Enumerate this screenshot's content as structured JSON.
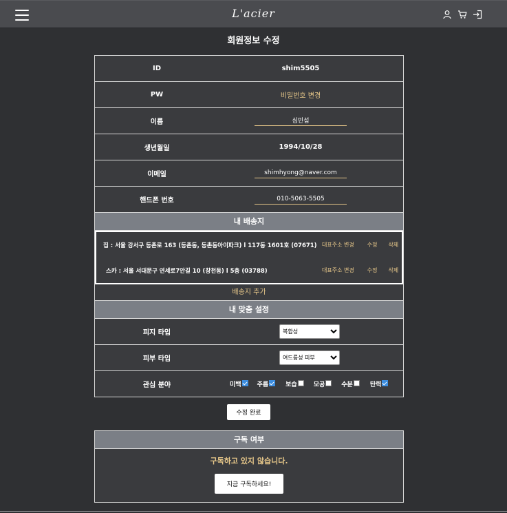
{
  "header": {
    "logo": "L'acier",
    "icons": [
      "user-icon",
      "cart-icon",
      "login-icon"
    ]
  },
  "page": {
    "title": "회원정보 수정"
  },
  "profile": {
    "id_label": "ID",
    "id_value": "shim5505",
    "pw_label": "PW",
    "pw_link": "비밀번호 변경",
    "name_label": "이름",
    "name_value": "심민섭",
    "birth_label": "생년월일",
    "birth_value": "1994/10/28",
    "email_label": "이메일",
    "email_value": "shimhyong@naver.com",
    "phone_label": "핸드폰 번호",
    "phone_value": "010-5063-5505"
  },
  "shipping": {
    "title": "내 배송지",
    "addresses": [
      {
        "text": "집 : 서울 강서구 등촌로 163 (등촌동, 등촌동아이파크) l 117동 1601호 (07671)",
        "set_default": "대표주소 변경",
        "edit": "수정",
        "delete": "삭제"
      },
      {
        "text": "스카 : 서울 서대문구 연세로7안길 10 (창천동) l 5층 (03788)",
        "set_default": "대표주소 변경",
        "edit": "수정",
        "delete": "삭제"
      }
    ],
    "add_label": "배송지 추가"
  },
  "custom": {
    "title": "내 맞춤 설정",
    "skin_type_label": "피지 타입",
    "skin_type_value": "복합성",
    "skin_kind_label": "피부 타입",
    "skin_kind_value": "여드름성 피부",
    "interest_label": "관심 분야",
    "interests": [
      {
        "label": "미백",
        "checked": true
      },
      {
        "label": "주름",
        "checked": true
      },
      {
        "label": "보습",
        "checked": false
      },
      {
        "label": "모공",
        "checked": false
      },
      {
        "label": "수분",
        "checked": false
      },
      {
        "label": "탄력",
        "checked": true
      }
    ]
  },
  "submit_label": "수정 완료",
  "subscription": {
    "title": "구독 여부",
    "message": "구독하고 있지 않습니다.",
    "button": "지금 구독하세요!"
  },
  "colors": {
    "accent": "#e8c88a",
    "background": "#2f3033",
    "section_head": "#7b7f86",
    "checkbox": "#3d8ee0"
  }
}
